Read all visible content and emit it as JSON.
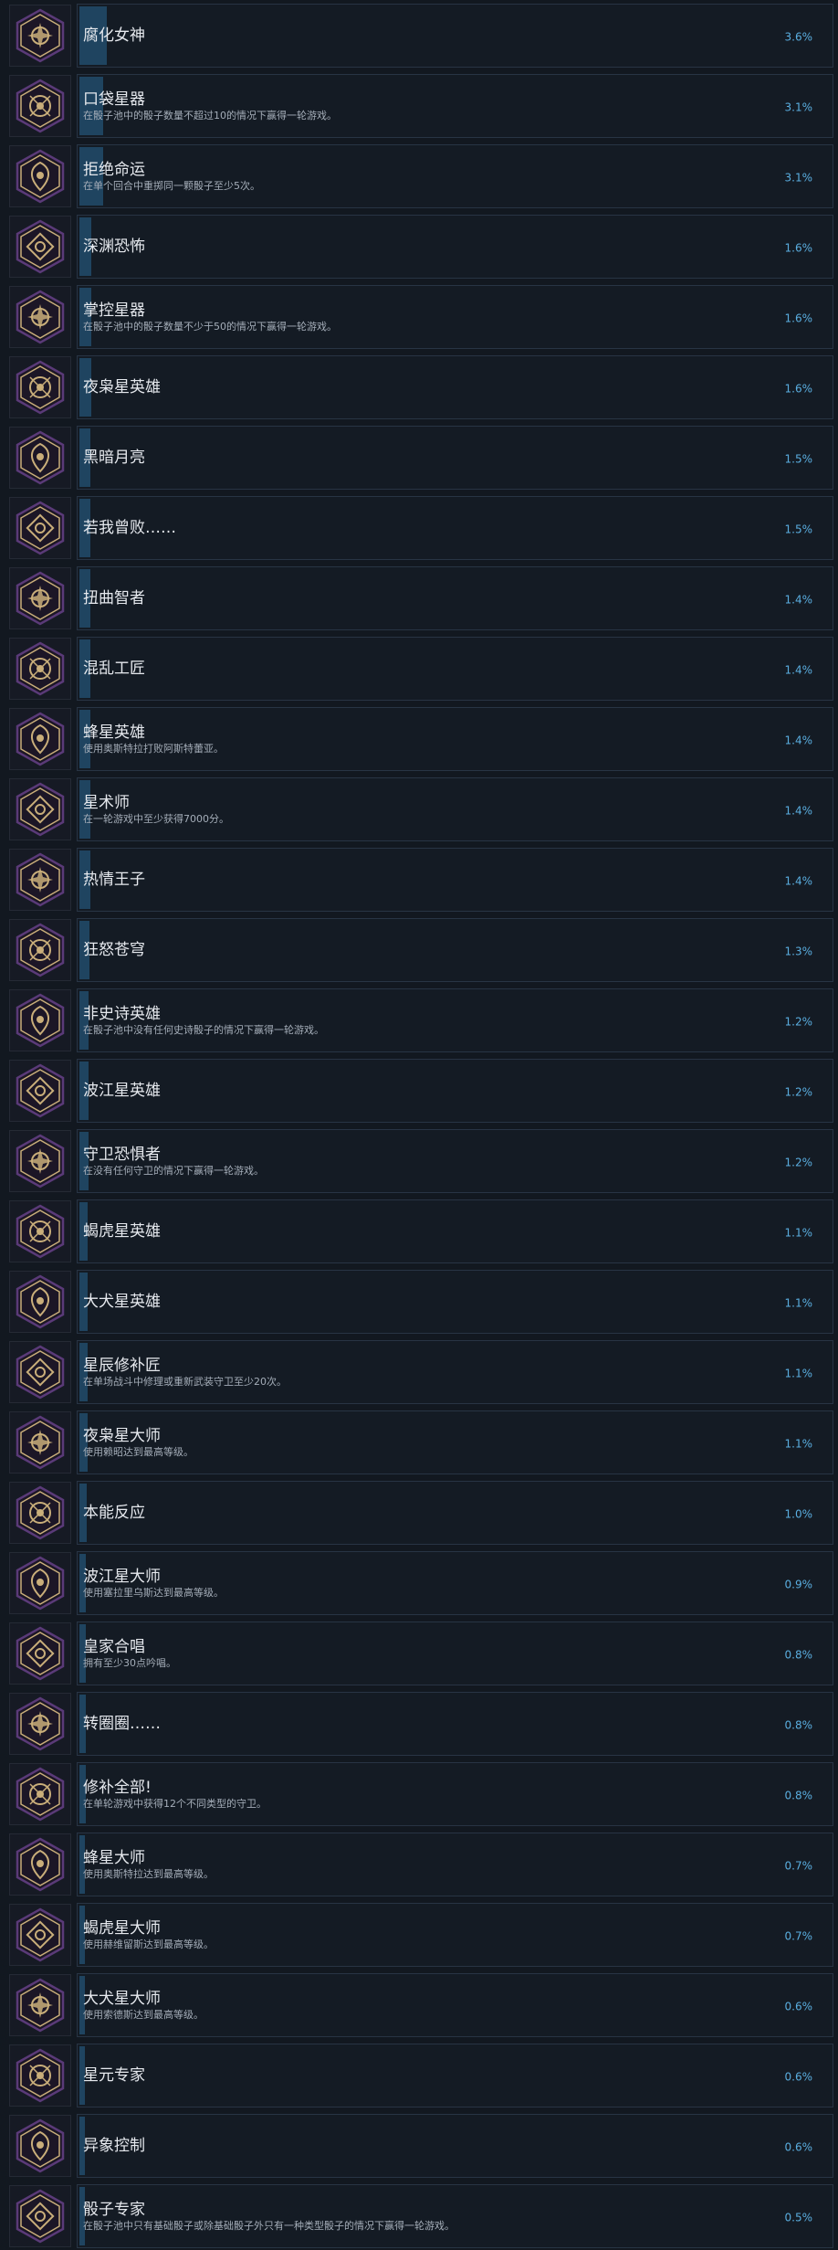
{
  "colors": {
    "background": "#121820",
    "panel": "#141b24",
    "panel_border": "#283444",
    "progress_fill": "#1f4460",
    "percent_text": "#5aaee0",
    "icon_gold": "#c9ae7a",
    "icon_purple": "#5a3a78"
  },
  "achievements": [
    {
      "title": "腐化女神",
      "desc": "",
      "pct": "3.6%",
      "icon": "corrupted-goddess-icon"
    },
    {
      "title": "口袋星器",
      "desc": "在骰子池中的骰子数量不超过10的情况下赢得一轮游戏。",
      "pct": "3.1%",
      "icon": "pocket-star-icon"
    },
    {
      "title": "拒绝命运",
      "desc": "在单个回合中重掷同一颗骰子至少5次。",
      "pct": "3.1%",
      "icon": "defy-fate-icon"
    },
    {
      "title": "深渊恐怖",
      "desc": "",
      "pct": "1.6%",
      "icon": "abyssal-horror-icon"
    },
    {
      "title": "掌控星器",
      "desc": "在骰子池中的骰子数量不少于50的情况下赢得一轮游戏。",
      "pct": "1.6%",
      "icon": "master-star-icon"
    },
    {
      "title": "夜枭星英雄",
      "desc": "",
      "pct": "1.6%",
      "icon": "owl-hero-icon"
    },
    {
      "title": "黑暗月亮",
      "desc": "",
      "pct": "1.5%",
      "icon": "dark-moon-icon"
    },
    {
      "title": "若我曾败……",
      "desc": "",
      "pct": "1.5%",
      "icon": "if-i-failed-icon"
    },
    {
      "title": "扭曲智者",
      "desc": "",
      "pct": "1.4%",
      "icon": "twisted-sage-icon"
    },
    {
      "title": "混乱工匠",
      "desc": "",
      "pct": "1.4%",
      "icon": "chaos-artisan-icon"
    },
    {
      "title": "蜂星英雄",
      "desc": "使用奥斯特拉打败阿斯特蕾亚。",
      "pct": "1.4%",
      "icon": "bee-hero-icon"
    },
    {
      "title": "星术师",
      "desc": "在一轮游戏中至少获得7000分。",
      "pct": "1.4%",
      "icon": "astromancer-icon"
    },
    {
      "title": "热情王子",
      "desc": "",
      "pct": "1.4%",
      "icon": "passion-prince-icon"
    },
    {
      "title": "狂怒苍穹",
      "desc": "",
      "pct": "1.3%",
      "icon": "raging-sky-icon"
    },
    {
      "title": "非史诗英雄",
      "desc": "在骰子池中没有任何史诗骰子的情况下赢得一轮游戏。",
      "pct": "1.2%",
      "icon": "non-epic-hero-icon"
    },
    {
      "title": "波江星英雄",
      "desc": "",
      "pct": "1.2%",
      "icon": "eridanus-hero-icon"
    },
    {
      "title": "守卫恐惧者",
      "desc": "在没有任何守卫的情况下赢得一轮游戏。",
      "pct": "1.2%",
      "icon": "guardian-fear-icon"
    },
    {
      "title": "蝎虎星英雄",
      "desc": "",
      "pct": "1.1%",
      "icon": "lacerta-hero-icon"
    },
    {
      "title": "大犬星英雄",
      "desc": "",
      "pct": "1.1%",
      "icon": "canis-major-hero-icon"
    },
    {
      "title": "星辰修补匠",
      "desc": "在单场战斗中修理或重新武装守卫至少20次。",
      "pct": "1.1%",
      "icon": "star-tinker-icon"
    },
    {
      "title": "夜枭星大师",
      "desc": "使用赖昭达到最高等级。",
      "pct": "1.1%",
      "icon": "owl-master-icon"
    },
    {
      "title": "本能反应",
      "desc": "",
      "pct": "1.0%",
      "icon": "instinct-icon"
    },
    {
      "title": "波江星大师",
      "desc": "使用塞拉里乌斯达到最高等级。",
      "pct": "0.9%",
      "icon": "eridanus-master-icon"
    },
    {
      "title": "皇家合唱",
      "desc": "拥有至少30点吟唱。",
      "pct": "0.8%",
      "icon": "royal-chorus-icon"
    },
    {
      "title": "转圈圈……",
      "desc": "",
      "pct": "0.8%",
      "icon": "spinning-icon"
    },
    {
      "title": "修补全部!",
      "desc": "在单轮游戏中获得12个不同类型的守卫。",
      "pct": "0.8%",
      "icon": "fix-all-icon"
    },
    {
      "title": "蜂星大师",
      "desc": "使用奥斯特拉达到最高等级。",
      "pct": "0.7%",
      "icon": "bee-master-icon"
    },
    {
      "title": "蝎虎星大师",
      "desc": "使用赫维留斯达到最高等级。",
      "pct": "0.7%",
      "icon": "lacerta-master-icon"
    },
    {
      "title": "大犬星大师",
      "desc": "使用索德斯达到最高等级。",
      "pct": "0.6%",
      "icon": "canis-major-master-icon"
    },
    {
      "title": "星元专家",
      "desc": "",
      "pct": "0.6%",
      "icon": "star-element-expert-icon"
    },
    {
      "title": "异象控制",
      "desc": "",
      "pct": "0.6%",
      "icon": "anomaly-control-icon"
    },
    {
      "title": "骰子专家",
      "desc": "在骰子池中只有基础骰子或除基础骰子外只有一种类型骰子的情况下赢得一轮游戏。",
      "pct": "0.5%",
      "icon": "dice-expert-icon"
    }
  ]
}
